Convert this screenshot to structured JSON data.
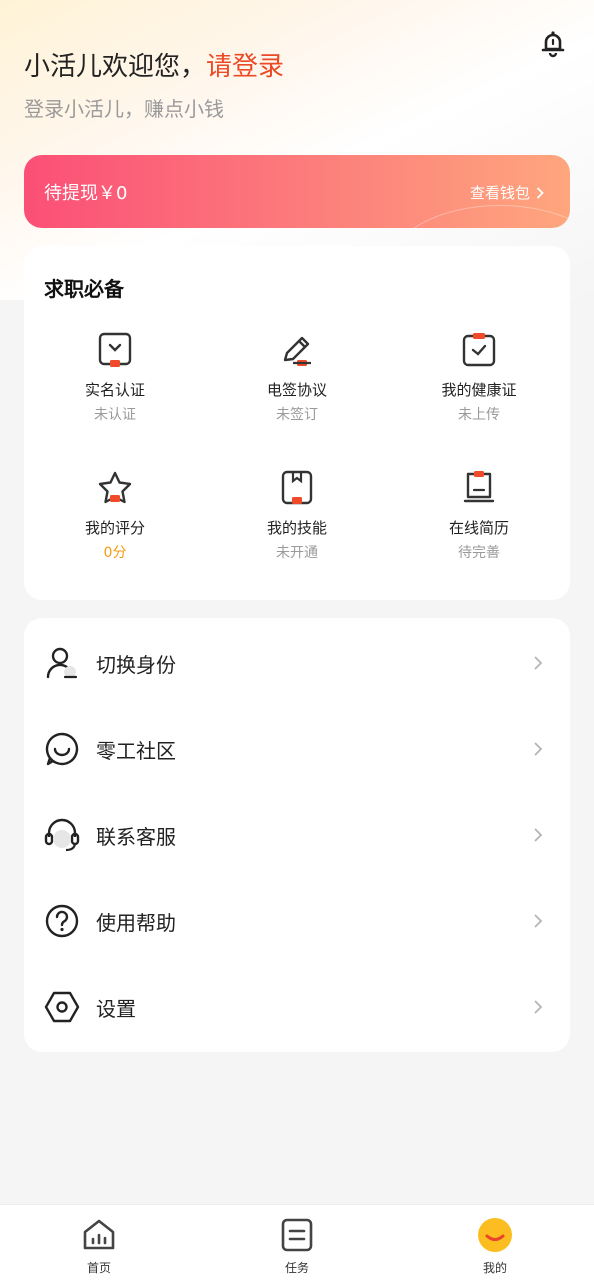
{
  "header": {
    "greeting": "小活儿欢迎您，",
    "login_link": "请登录",
    "subtitle": "登录小活儿，赚点小钱"
  },
  "wallet": {
    "pending_label": "待提现￥0",
    "view_wallet": "查看钱包"
  },
  "job_essentials": {
    "title": "求职必备",
    "items": [
      {
        "label": "实名认证",
        "status": "未认证"
      },
      {
        "label": "电签协议",
        "status": "未签订"
      },
      {
        "label": "我的健康证",
        "status": "未上传"
      },
      {
        "label": "我的评分",
        "status": "0分"
      },
      {
        "label": "我的技能",
        "status": "未开通"
      },
      {
        "label": "在线简历",
        "status": "待完善"
      }
    ]
  },
  "menu": {
    "items": [
      {
        "label": "切换身份",
        "icon": "switch-identity-icon"
      },
      {
        "label": "零工社区",
        "icon": "chat-bubble-icon"
      },
      {
        "label": "联系客服",
        "icon": "headset-icon"
      },
      {
        "label": "使用帮助",
        "icon": "help-icon"
      },
      {
        "label": "设置",
        "icon": "settings-icon"
      }
    ]
  },
  "tabbar": {
    "items": [
      {
        "label": "首页",
        "icon": "home-icon"
      },
      {
        "label": "任务",
        "icon": "task-icon"
      },
      {
        "label": "我的",
        "icon": "profile-smile-icon"
      }
    ]
  },
  "colors": {
    "accent_red": "#ec4a25",
    "wallet_gradient_start": "#fb4f76",
    "wallet_gradient_end": "#fea67d",
    "rating_orange": "#f39c12",
    "icon_badge": "#f04a2a"
  }
}
